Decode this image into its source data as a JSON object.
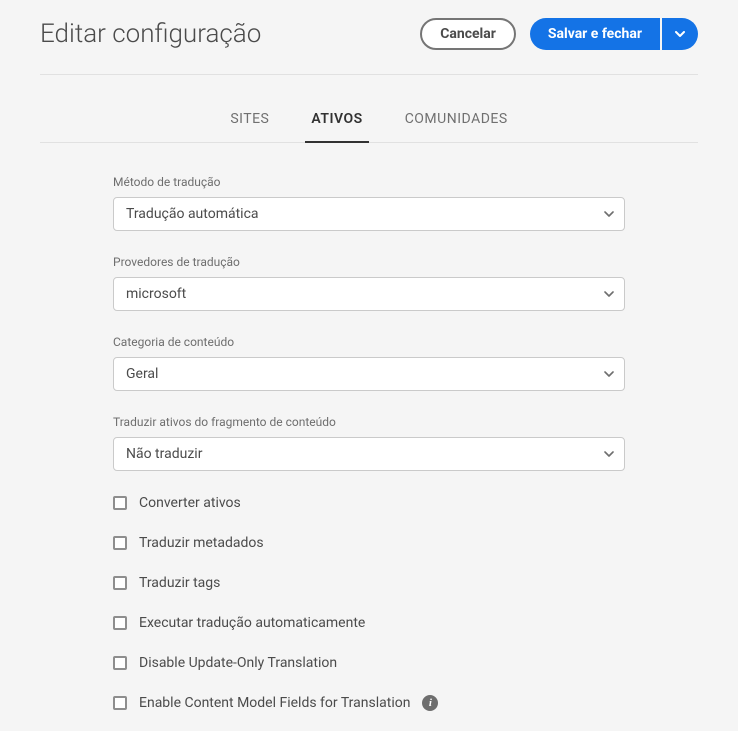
{
  "header": {
    "title": "Editar configuração",
    "cancel_label": "Cancelar",
    "save_label": "Salvar e fechar"
  },
  "tabs": [
    {
      "label": "SITES",
      "active": false
    },
    {
      "label": "ATIVOS",
      "active": true
    },
    {
      "label": "COMUNIDADES",
      "active": false
    }
  ],
  "fields": {
    "method": {
      "label": "Método de tradução",
      "value": "Tradução automática"
    },
    "providers": {
      "label": "Provedores de tradução",
      "value": "microsoft"
    },
    "category": {
      "label": "Categoria de conteúdo",
      "value": "Geral"
    },
    "fragment": {
      "label": "Traduzir ativos do fragmento de conteúdo",
      "value": "Não traduzir"
    }
  },
  "checkboxes": [
    {
      "label": "Converter ativos",
      "info": false
    },
    {
      "label": "Traduzir metadados",
      "info": false
    },
    {
      "label": "Traduzir tags",
      "info": false
    },
    {
      "label": "Executar tradução automaticamente",
      "info": false
    },
    {
      "label": "Disable Update-Only Translation",
      "info": false
    },
    {
      "label": "Enable Content Model Fields for Translation",
      "info": true
    }
  ],
  "colors": {
    "primary": "#1473e6",
    "border": "#e1e1e1",
    "text": "#4b4b4b"
  }
}
